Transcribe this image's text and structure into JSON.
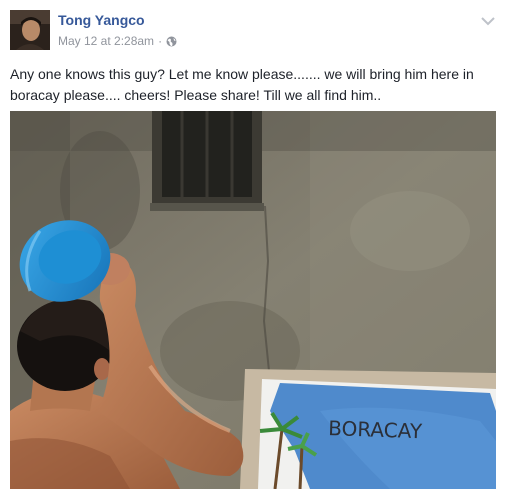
{
  "post": {
    "author": "Tong Yangco",
    "timestamp": "May 12 at 2:28am",
    "separator": "·",
    "privacy_icon": "globe-icon",
    "options_icon": "chevron-down-icon",
    "text": "Any one knows this guy? Let me know please....... we will bring him here in boracay please.... cheers! Please share! Till we all find him..",
    "photo": {
      "sign_text": "BORACAY"
    }
  },
  "colors": {
    "author_link": "#365899",
    "meta_text": "#90949c",
    "body_text": "#1d2129"
  }
}
